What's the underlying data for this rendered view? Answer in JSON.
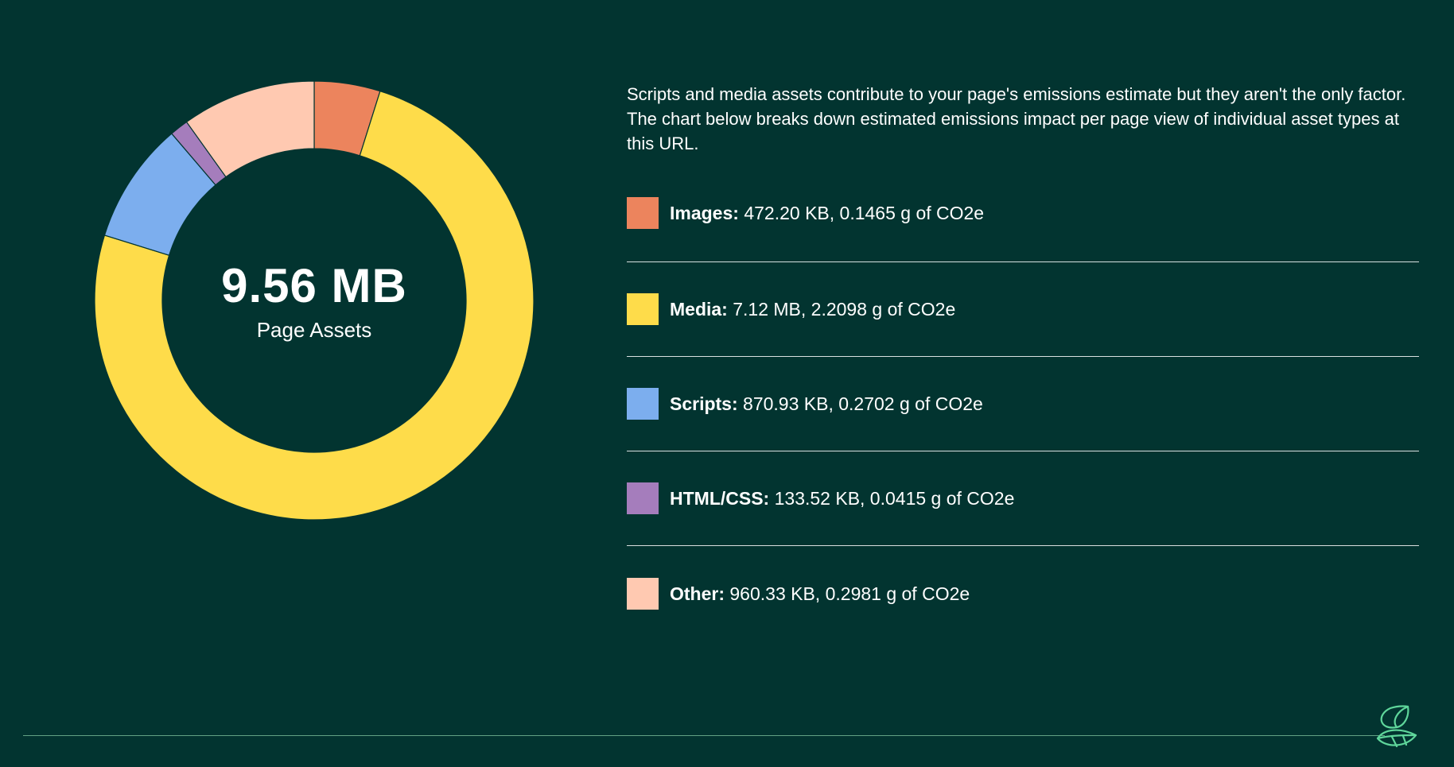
{
  "chart_data": {
    "type": "pie",
    "center_value": "9.56 MB",
    "center_label": "Page Assets",
    "series": [
      {
        "name": "Images",
        "size": "472.20 KB",
        "emissions": "0.1465 g of CO2e",
        "value_kb": 472.2,
        "color": "#EC845D"
      },
      {
        "name": "Media",
        "size": "7.12 MB",
        "emissions": "2.2098 g of CO2e",
        "value_kb": 7290.88,
        "color": "#FEDC4A"
      },
      {
        "name": "Scripts",
        "size": "870.93 KB",
        "emissions": "0.2702 g of CO2e",
        "value_kb": 870.93,
        "color": "#7CAEEE"
      },
      {
        "name": "HTML/CSS",
        "size": "133.52 KB",
        "emissions": "0.0415 g of CO2e",
        "value_kb": 133.52,
        "color": "#A57DBC"
      },
      {
        "name": "Other",
        "size": "960.33 KB",
        "emissions": "0.2981 g of CO2e",
        "value_kb": 960.33,
        "color": "#FFC9B1"
      }
    ]
  },
  "intro": "Scripts and media assets contribute to your page's emissions estimate but they aren't the only factor. The chart below breaks down estimated emissions impact per page view of individual asset types at this URL.",
  "legend": [
    {
      "label": "Images:",
      "detail": "472.20 KB, 0.1465 g of CO2e"
    },
    {
      "label": "Media:",
      "detail": "7.12 MB, 2.2098 g of CO2e"
    },
    {
      "label": "Scripts:",
      "detail": "870.93 KB, 0.2702 g of CO2e"
    },
    {
      "label": "HTML/CSS:",
      "detail": "133.52 KB, 0.0415 g of CO2e"
    },
    {
      "label": "Other:",
      "detail": "960.33 KB, 0.2981 g of CO2e"
    }
  ],
  "colors": {
    "background": "#023430",
    "divider": "#ffffff",
    "footer_line": "#8CD2AA",
    "logo": "#5FD69B"
  },
  "icons": {
    "logo": "leaf-logo-icon"
  }
}
